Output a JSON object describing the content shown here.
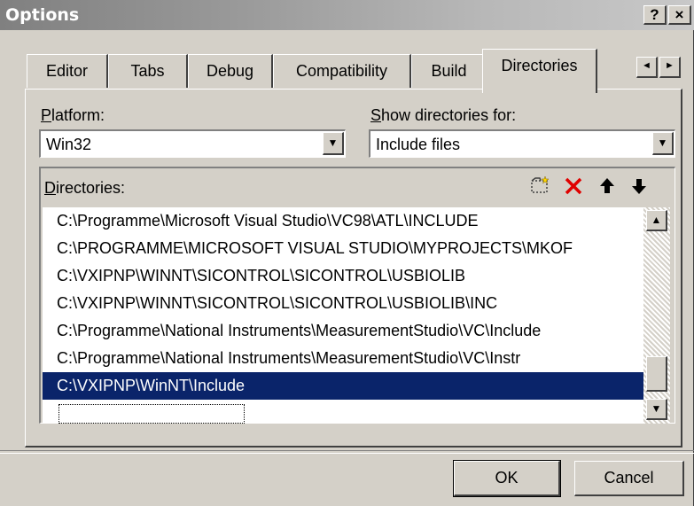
{
  "window": {
    "title": "Options",
    "help_label": "?",
    "close_label": "×"
  },
  "tabs": [
    {
      "label": "Editor"
    },
    {
      "label": "Tabs"
    },
    {
      "label": "Debug"
    },
    {
      "label": "Compatibility"
    },
    {
      "label": "Build"
    },
    {
      "label": "Directories",
      "active": true
    }
  ],
  "tab_scroll": {
    "left": "◄",
    "right": "►"
  },
  "platform": {
    "label_underlined": "P",
    "label_rest": "latform:",
    "value": "Win32"
  },
  "show_for": {
    "label_underlined": "S",
    "label_rest": "how directories for:",
    "value": "Include files"
  },
  "directories": {
    "label_underlined": "D",
    "label_rest": "irectories:",
    "tools": {
      "new_icon": "new-folder-icon",
      "delete_icon": "delete-icon",
      "up_icon": "arrow-up-icon",
      "down_icon": "arrow-down-icon"
    },
    "items": [
      "C:\\Programme\\Microsoft Visual Studio\\VC98\\ATL\\INCLUDE",
      "C:\\PROGRAMME\\MICROSOFT VISUAL STUDIO\\MYPROJECTS\\MKOF",
      "C:\\VXIPNP\\WINNT\\SICONTROL\\SICONTROL\\USBIOLIB",
      "C:\\VXIPNP\\WINNT\\SICONTROL\\SICONTROL\\USBIOLIB\\INC",
      "C:\\Programme\\National Instruments\\MeasurementStudio\\VC\\Include",
      "C:\\Programme\\National Instruments\\MeasurementStudio\\VC\\Instr",
      "C:\\VXIPNP\\WinNT\\Include"
    ],
    "selected_index": 6
  },
  "buttons": {
    "ok": "OK",
    "cancel": "Cancel"
  }
}
